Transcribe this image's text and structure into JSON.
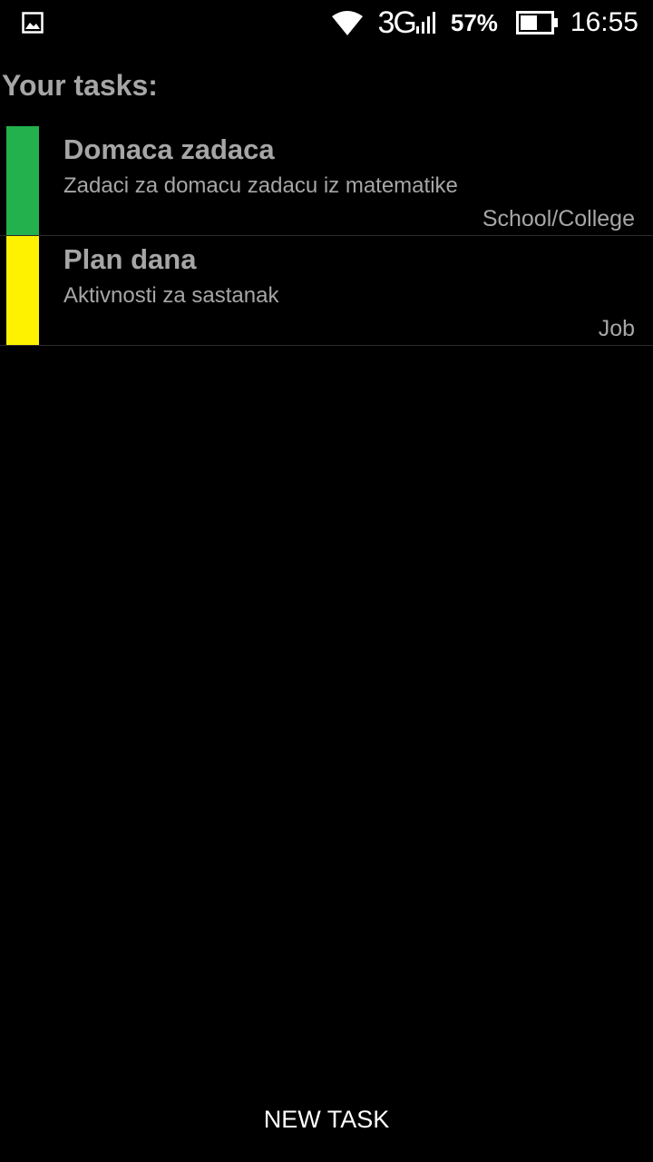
{
  "status_bar": {
    "network": "3G",
    "battery_percent": "57%",
    "time": "16:55",
    "icons": [
      "gallery-icon",
      "wifi-icon",
      "signal-icon",
      "battery-icon"
    ]
  },
  "header": {
    "title": "Your tasks:"
  },
  "tasks": [
    {
      "title": "Domaca zadaca",
      "description": "Zadaci za domacu zadacu iz matematike",
      "category": "School/College",
      "color": "#22b14c"
    },
    {
      "title": "Plan dana",
      "description": "Aktivnosti za sastanak",
      "category": "Job",
      "color": "#fff200"
    }
  ],
  "footer": {
    "new_task_label": "NEW TASK"
  },
  "colors": {
    "background": "#000000",
    "text": "#a6a6a6",
    "button_text": "#ffffff"
  }
}
